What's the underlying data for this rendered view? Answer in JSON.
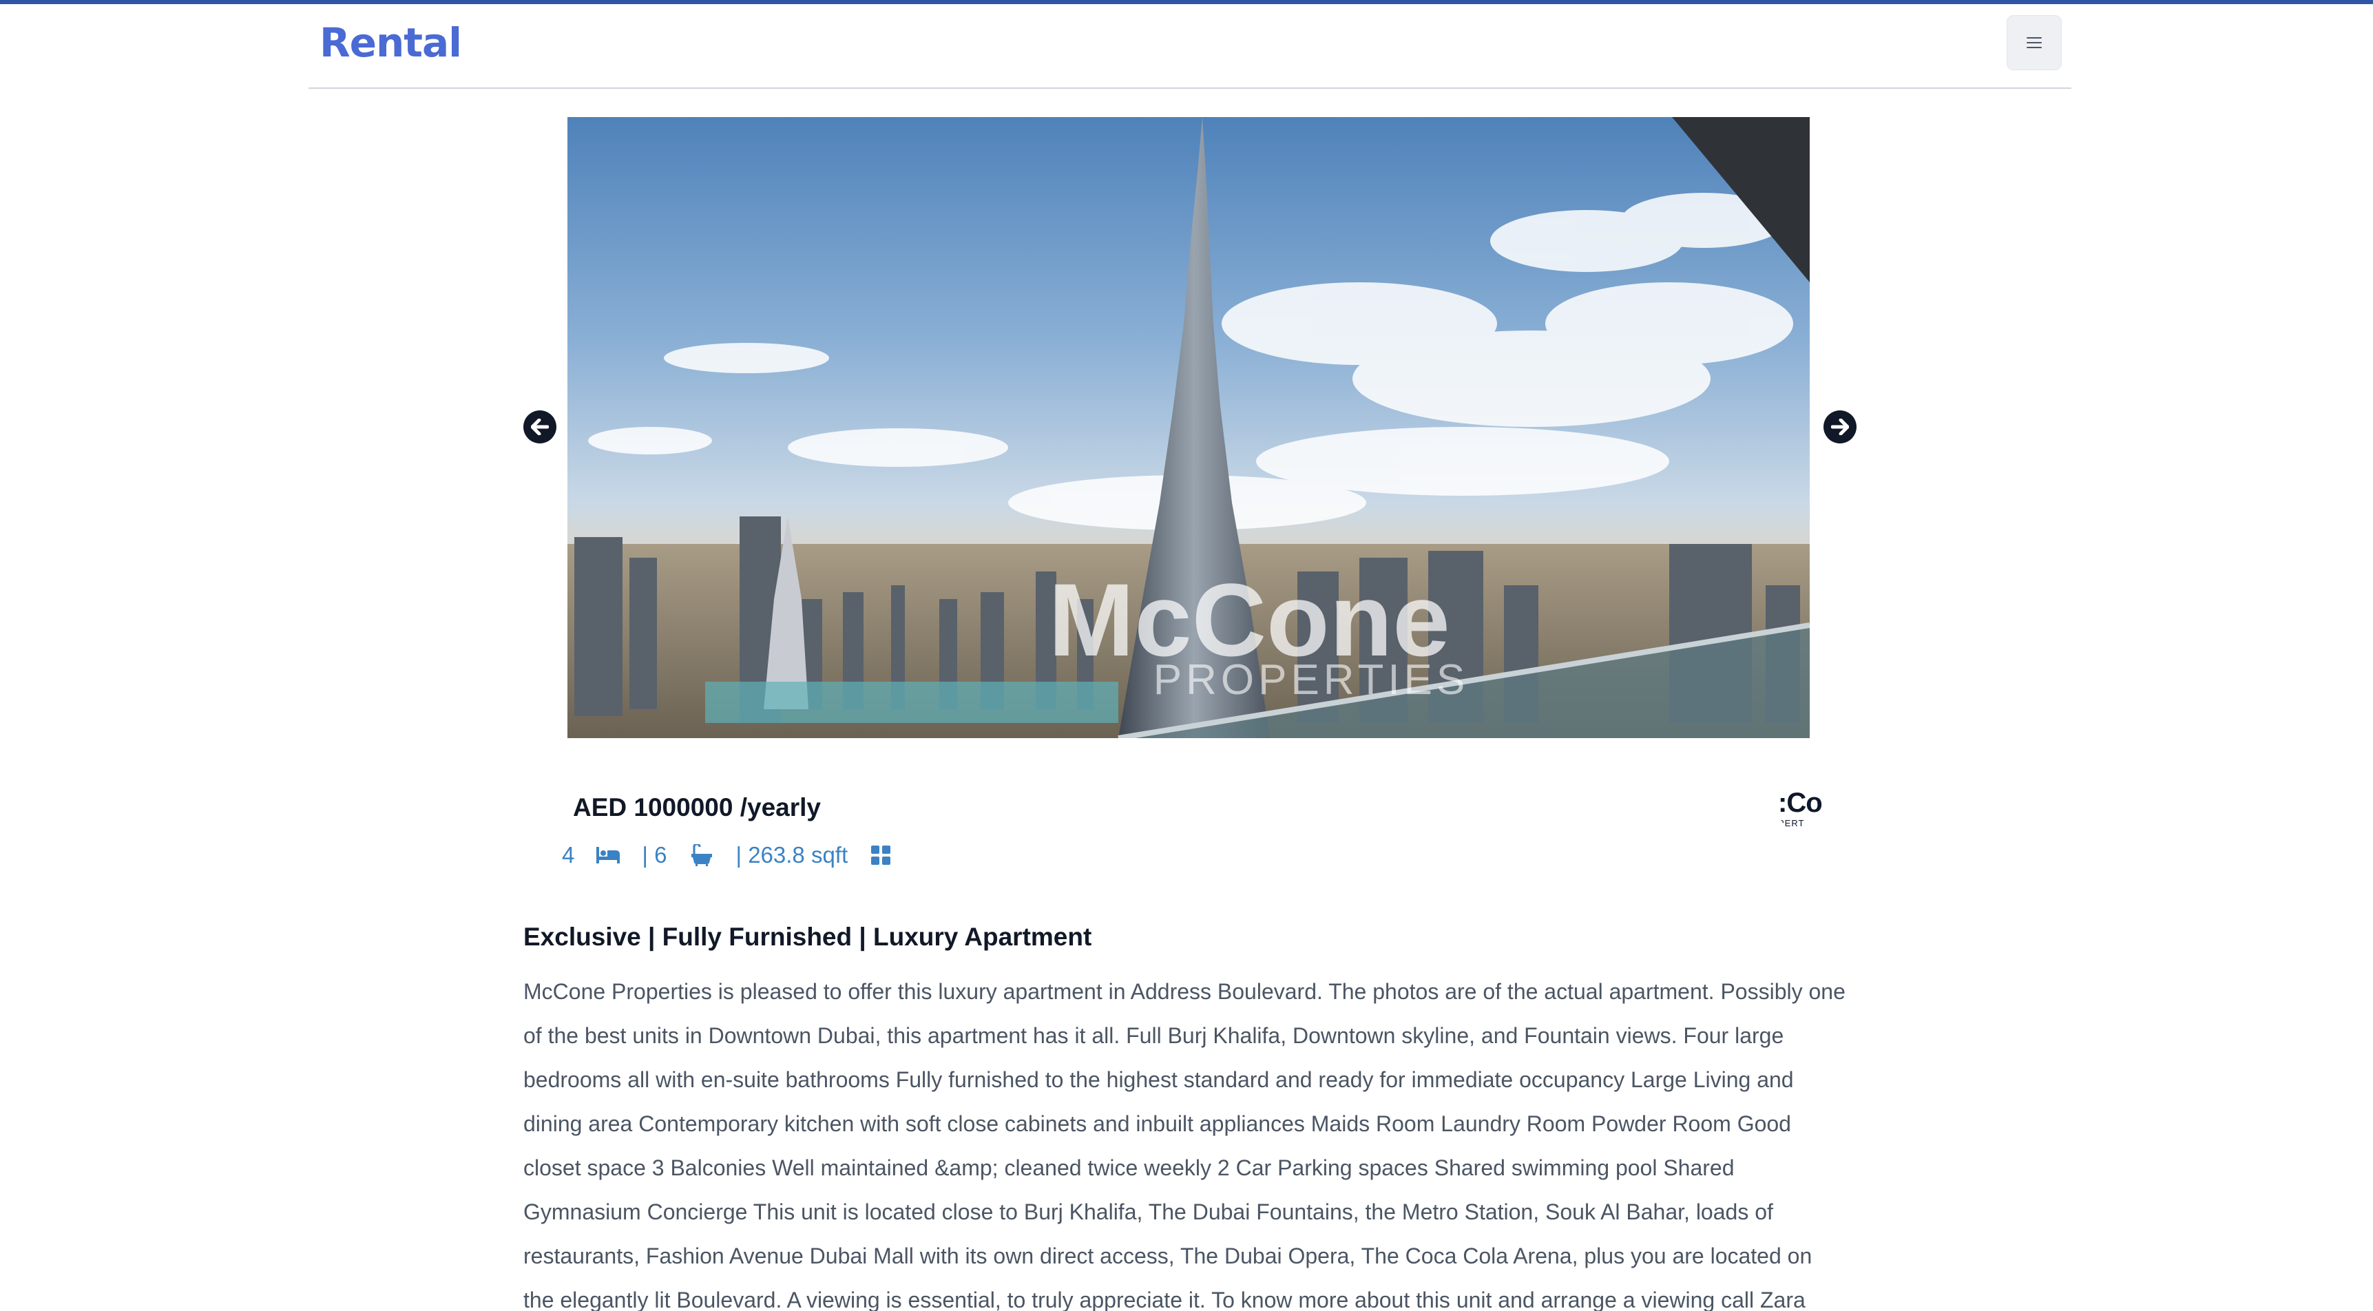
{
  "header": {
    "brand": "Rental",
    "menu_icon": "hamburger-menu-icon"
  },
  "carousel": {
    "watermark_text": "McCone",
    "watermark_sub": "PROPERTIES",
    "prev_icon": "arrow-left-circle-icon",
    "next_icon": "arrow-right-circle-icon"
  },
  "listing": {
    "price": "AED 1000000 /yearly",
    "bedrooms": "4",
    "bathrooms": "| 6",
    "area": "| 263.8 sqft",
    "bed_icon": "bed-icon",
    "bath_icon": "bathtub-icon",
    "area_icon": "grid-icon",
    "agency_logo_text": ":Co",
    "agency_logo_sub": "PERT",
    "title": "Exclusive | Fully Furnished | Luxury Apartment",
    "description": "McCone Properties is pleased to offer this luxury apartment in Address Boulevard. The photos are of the actual apartment. Possibly one of the best units in Downtown Dubai, this apartment has it all. Full Burj Khalifa, Downtown skyline, and Fountain views. Four large bedrooms all with en-suite bathrooms Fully furnished to the highest standard and ready for immediate occupancy Large Living and dining area Contemporary kitchen with soft close cabinets and inbuilt appliances Maids Room Laundry Room Powder Room Good closet space 3 Balconies Well maintained &amp; cleaned twice weekly 2 Car Parking spaces Shared swimming pool Shared Gymnasium Concierge This unit is located close to Burj Khalifa, The Dubai Fountains, the Metro Station, Souk Al Bahar, loads of restaurants, Fashion Avenue Dubai Mall with its own direct access, The Dubai Opera, The Coca Cola Arena, plus you are located on the elegantly lit Boulevard. A viewing is essential, to truly appreciate it. To know more about this unit and arrange a viewing call Zara"
  },
  "colors": {
    "brand": "#4a6ad4",
    "top_border": "#2f55a4",
    "feature_blue": "#3b82c4",
    "heading": "#111827",
    "body_text": "#4b5563"
  }
}
